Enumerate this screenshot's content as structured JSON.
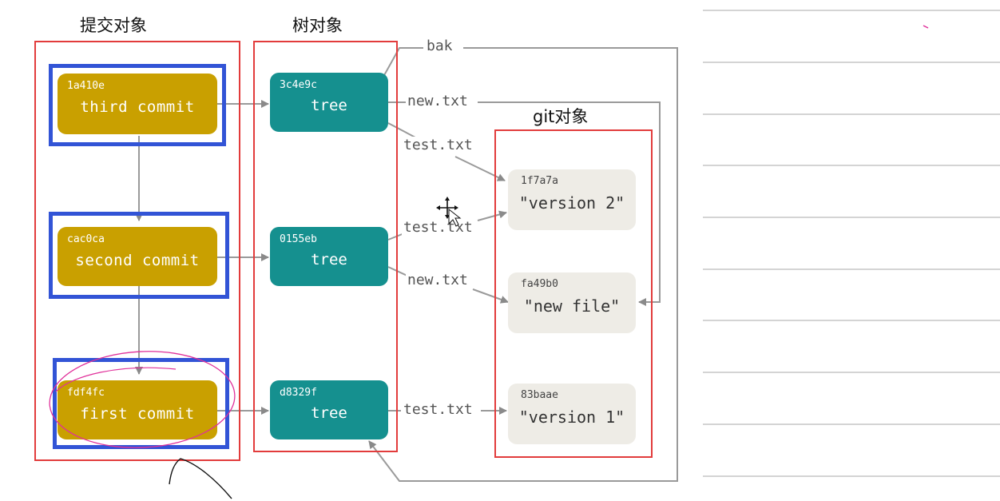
{
  "headings": {
    "commit_objects": "提交对象",
    "tree_objects": "树对象",
    "git_objects": "git对象"
  },
  "commits": [
    {
      "hash": "1a410e",
      "label": "third commit"
    },
    {
      "hash": "cac0ca",
      "label": "second commit"
    },
    {
      "hash": "fdf4fc",
      "label": "first commit"
    }
  ],
  "trees": [
    {
      "hash": "3c4e9c",
      "label": "tree"
    },
    {
      "hash": "0155eb",
      "label": "tree"
    },
    {
      "hash": "d8329f",
      "label": "tree"
    }
  ],
  "blobs": [
    {
      "hash": "1f7a7a",
      "label": "\"version 2\""
    },
    {
      "hash": "fa49b0",
      "label": "\"new file\""
    },
    {
      "hash": "83baae",
      "label": "\"version 1\""
    }
  ],
  "edge_labels": {
    "bak": "bak",
    "t1_new": "new.txt",
    "t1_test": "test.txt",
    "t2_test": "test.txt",
    "t2_new": "new.txt",
    "t3_test": "test.txt"
  },
  "colors": {
    "commit": "#c9a000",
    "tree": "#15908f",
    "blob": "#eeece6",
    "group_frame": "#e23c3c",
    "commit_highlight": "#3254d6",
    "annotation_ink": "#e0309a"
  }
}
